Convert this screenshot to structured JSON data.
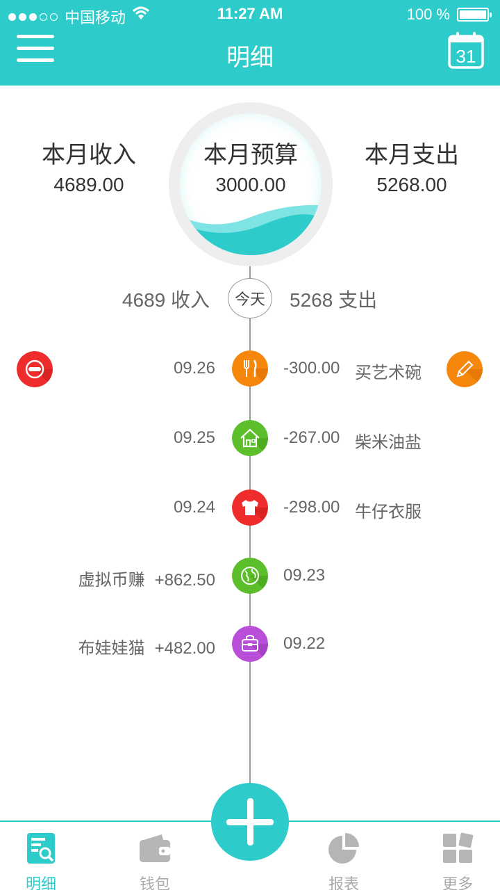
{
  "status": {
    "carrier": "中国移动",
    "time": "11:27 AM",
    "battery": "100 %"
  },
  "header": {
    "title": "明细",
    "menu_icon": "hamburger-menu-icon",
    "calendar_icon": "calendar-icon",
    "calendar_day": "31"
  },
  "summary": {
    "income": {
      "label": "本月收入",
      "value": "4689.00"
    },
    "budget": {
      "label": "本月预算",
      "value": "3000.00"
    },
    "expense": {
      "label": "本月支出",
      "value": "5268.00"
    }
  },
  "today": {
    "income_text": "4689 收入",
    "label": "今天",
    "expense_text": "5268 支出"
  },
  "entries": [
    {
      "date": "09.26",
      "amount": "-300.00",
      "name": "买艺术碗",
      "icon": "dining-icon",
      "color": "#f5870d",
      "type": "expense"
    },
    {
      "date": "09.25",
      "amount": "-267.00",
      "name": "柴米油盐",
      "icon": "home-icon",
      "color": "#5cbe2a",
      "type": "expense"
    },
    {
      "date": "09.24",
      "amount": "-298.00",
      "name": "牛仔衣服",
      "icon": "tshirt-icon",
      "color": "#ee2c2c",
      "type": "expense"
    },
    {
      "date": "09.23",
      "amount": "+862.50",
      "name": "虚拟币赚",
      "icon": "globe-icon",
      "color": "#5cbe2a",
      "type": "income"
    },
    {
      "date": "09.22",
      "amount": "+482.00",
      "name": "布娃娃猫",
      "icon": "bag-icon",
      "color": "#b94fd8",
      "type": "income"
    }
  ],
  "actions": {
    "delete_icon": "delete-icon",
    "delete_color": "#ee2c2c",
    "edit_icon": "pencil-icon",
    "edit_color": "#f5870d"
  },
  "tabs": [
    {
      "label": "明细",
      "icon": "detail-search-icon",
      "active": true
    },
    {
      "label": "钱包",
      "icon": "wallet-icon",
      "active": false
    },
    {
      "label": "报表",
      "icon": "pie-chart-icon",
      "active": false
    },
    {
      "label": "更多",
      "icon": "more-grid-icon",
      "active": false
    }
  ],
  "fab": {
    "icon": "plus-icon"
  },
  "colors": {
    "primary": "#2ecbcb",
    "text": "#333333",
    "muted": "#666666"
  }
}
